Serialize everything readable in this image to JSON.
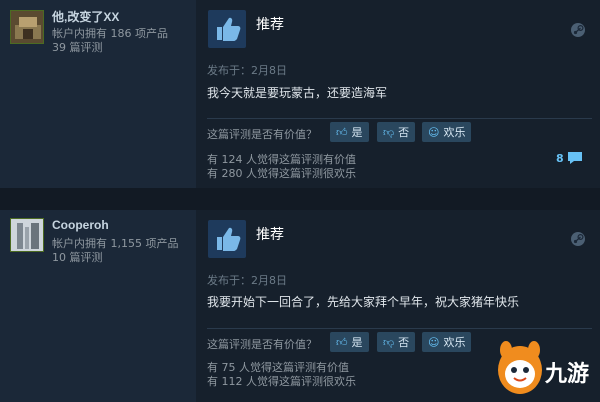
{
  "reviews": [
    {
      "username": "他,改变了XX",
      "products_owned": "帐户内拥有 186 项产品",
      "review_count": "39 篇评测",
      "verdict": "推荐",
      "posted": "发布于：2月8日",
      "text": "我今天就是要玩蒙古，还要造海军",
      "helpful_question": "这篇评测是否有价值？",
      "btn_yes": "是",
      "btn_no": "否",
      "btn_funny": "欢乐",
      "helpful_stat": "有 124 人觉得这篇评测有价值",
      "funny_stat": "有 280 人觉得这篇评测很欢乐",
      "comments": "8"
    },
    {
      "username": "Cooperoh",
      "products_owned": "帐户内拥有 1,155 项产品",
      "review_count": "10 篇评测",
      "verdict": "推荐",
      "posted": "发布于：2月8日",
      "text": "我要开始下一回合了，先给大家拜个早年，祝大家猪年快乐",
      "helpful_question": "这篇评测是否有价值？",
      "btn_yes": "是",
      "btn_no": "否",
      "btn_funny": "欢乐",
      "helpful_stat": "有 75 人觉得这篇评测有价值",
      "funny_stat": "有 112 人觉得这篇评测很欢乐"
    }
  ],
  "watermark": {
    "text": "九游"
  },
  "colors": {
    "background": "#1b2838",
    "accent": "#67c1f5",
    "thumb": "#1e3a5c",
    "watermark_orange": "#f08c1e"
  }
}
